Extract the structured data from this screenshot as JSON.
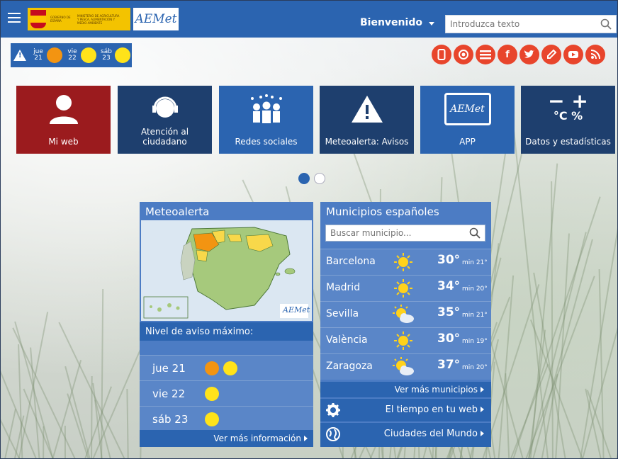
{
  "header": {
    "welcome": "Bienvenido",
    "search_placeholder": "Introduzca texto",
    "aemet_logo": "AEMet",
    "gov_text": "GOBIERNO DE ESPAÑA",
    "ministry_text": "MINISTERIO DE AGRICULTURA Y PESCA, ALIMENTACIÓN Y MEDIO AMBIENTE"
  },
  "forecast_strip": [
    {
      "day": "jue",
      "date": "21"
    },
    {
      "day": "vie",
      "date": "22"
    },
    {
      "day": "sáb",
      "date": "23"
    }
  ],
  "social": [
    {
      "name": "mobile-icon",
      "glyph": "▯",
      "color": "#e8452c"
    },
    {
      "name": "location-icon",
      "glyph": "◉",
      "color": "#e8452c"
    },
    {
      "name": "list-icon",
      "glyph": "☰",
      "color": "#e8452c"
    },
    {
      "name": "facebook-icon",
      "glyph": "f",
      "color": "#e8452c"
    },
    {
      "name": "twitter-icon",
      "glyph": "t",
      "color": "#e8452c"
    },
    {
      "name": "blog-icon",
      "glyph": "✎",
      "color": "#e8452c"
    },
    {
      "name": "youtube-icon",
      "glyph": "▶",
      "color": "#e8452c"
    },
    {
      "name": "rss-icon",
      "glyph": "◗",
      "color": "#e8452c"
    }
  ],
  "tiles": [
    {
      "label": "Mi web",
      "color": "#9b1b1e"
    },
    {
      "label": "Atención al ciudadano",
      "color": "#1e3f6e"
    },
    {
      "label": "Redes sociales",
      "color": "#2b64b0"
    },
    {
      "label": "Meteoalerta: Avisos",
      "color": "#1e3f6e"
    },
    {
      "label": "APP",
      "color": "#2b64b0",
      "icon_text": "AEMet"
    },
    {
      "label": "Datos y estadísticas",
      "color": "#1e3f6e",
      "icon_text": "°C %"
    }
  ],
  "meteoalerta": {
    "title": "Meteoalerta",
    "nivel": "Nivel de aviso máximo:",
    "rows": [
      {
        "label": "jue 21"
      },
      {
        "label": "vie 22"
      },
      {
        "label": "sáb 23"
      }
    ],
    "more": "Ver más información",
    "map_logo": "AEMet"
  },
  "municipios": {
    "title": "Municipios españoles",
    "search_placeholder": "Buscar municipio...",
    "cities": [
      {
        "name": "Barcelona",
        "max": "30°",
        "min": "min 21°",
        "icon": "sun"
      },
      {
        "name": "Madrid",
        "max": "34°",
        "min": "min 20°",
        "icon": "sun"
      },
      {
        "name": "Sevilla",
        "max": "35°",
        "min": "min 21°",
        "icon": "sun-cloud"
      },
      {
        "name": "València",
        "max": "30°",
        "min": "min 19°",
        "icon": "sun"
      },
      {
        "name": "Zaragoza",
        "max": "37°",
        "min": "min 20°",
        "icon": "sun-cloud"
      }
    ],
    "more": "Ver más municipios",
    "links": [
      {
        "label": "El tiempo en tu web"
      },
      {
        "label": "Ciudades del Mundo"
      }
    ]
  }
}
